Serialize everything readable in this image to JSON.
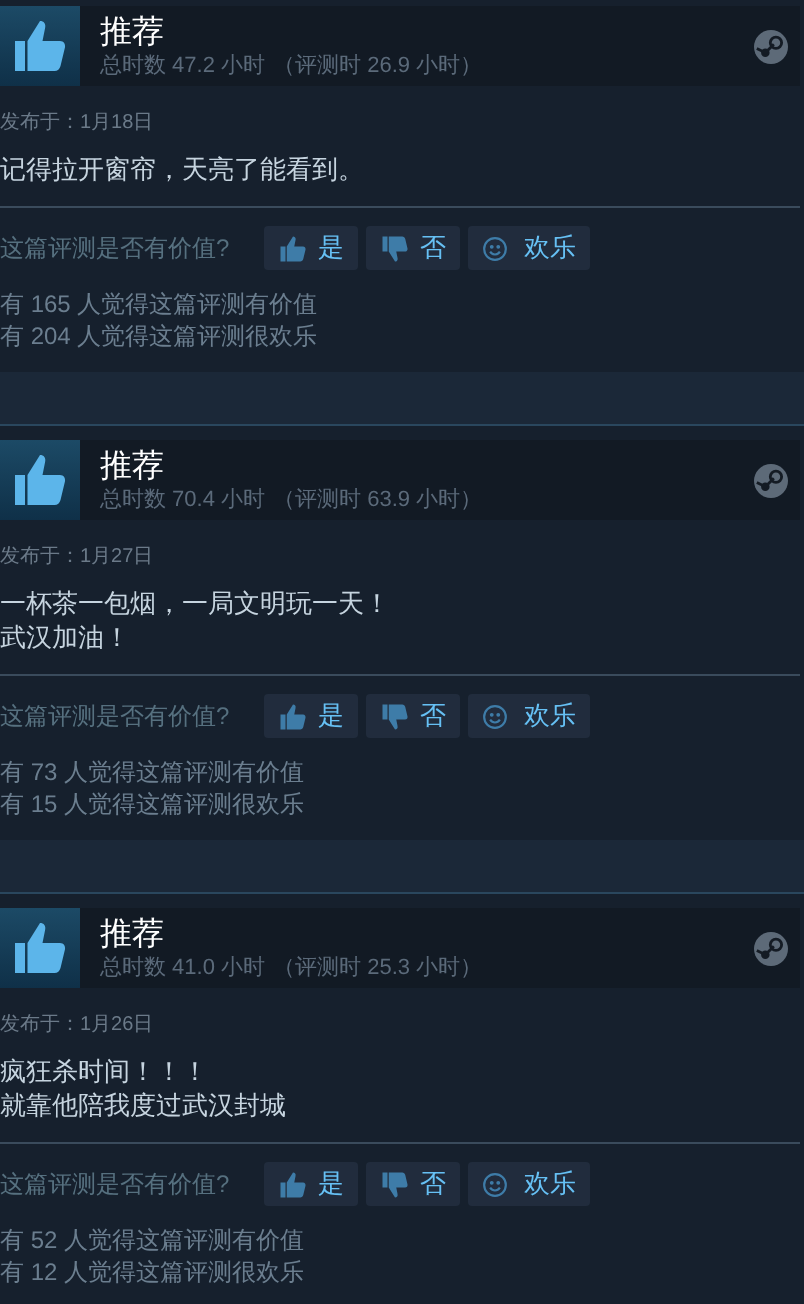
{
  "reviews": [
    {
      "verdict": "推荐",
      "hours": "总时数 47.2 小时",
      "hours_at_review": "（评测时 26.9 小时）",
      "posted": "发布于：1月18日",
      "body": [
        "记得拉开窗帘，天亮了能看到。"
      ],
      "question": "这篇评测是否有价值?",
      "buttons": [
        {
          "kind": "yes",
          "label": "是"
        },
        {
          "kind": "no",
          "label": "否"
        },
        {
          "kind": "funny",
          "label": "欢乐"
        }
      ],
      "counts": [
        "有 165 人觉得这篇评测有价值",
        "有 204 人觉得这篇评测很欢乐"
      ]
    },
    {
      "verdict": "推荐",
      "hours": "总时数 70.4 小时",
      "hours_at_review": "（评测时 63.9 小时）",
      "posted": "发布于：1月27日",
      "body": [
        "一杯茶一包烟，一局文明玩一天！",
        "武汉加油！"
      ],
      "question": "这篇评测是否有价值?",
      "buttons": [
        {
          "kind": "yes",
          "label": "是"
        },
        {
          "kind": "no",
          "label": "否"
        },
        {
          "kind": "funny",
          "label": "欢乐"
        }
      ],
      "counts": [
        "有 73 人觉得这篇评测有价值",
        "有 15 人觉得这篇评测很欢乐"
      ]
    },
    {
      "verdict": "推荐",
      "hours": "总时数 41.0 小时",
      "hours_at_review": "（评测时 25.3 小时）",
      "posted": "发布于：1月26日",
      "body": [
        "疯狂杀时间！！！",
        "就靠他陪我度过武汉封城"
      ],
      "question": "这篇评测是否有价值?",
      "buttons": [
        {
          "kind": "yes",
          "label": "是"
        },
        {
          "kind": "no",
          "label": "否"
        },
        {
          "kind": "funny",
          "label": "欢乐"
        }
      ],
      "counts": [
        "有 52 人觉得这篇评测有价值",
        "有 12 人觉得这篇评测很欢乐"
      ]
    }
  ]
}
